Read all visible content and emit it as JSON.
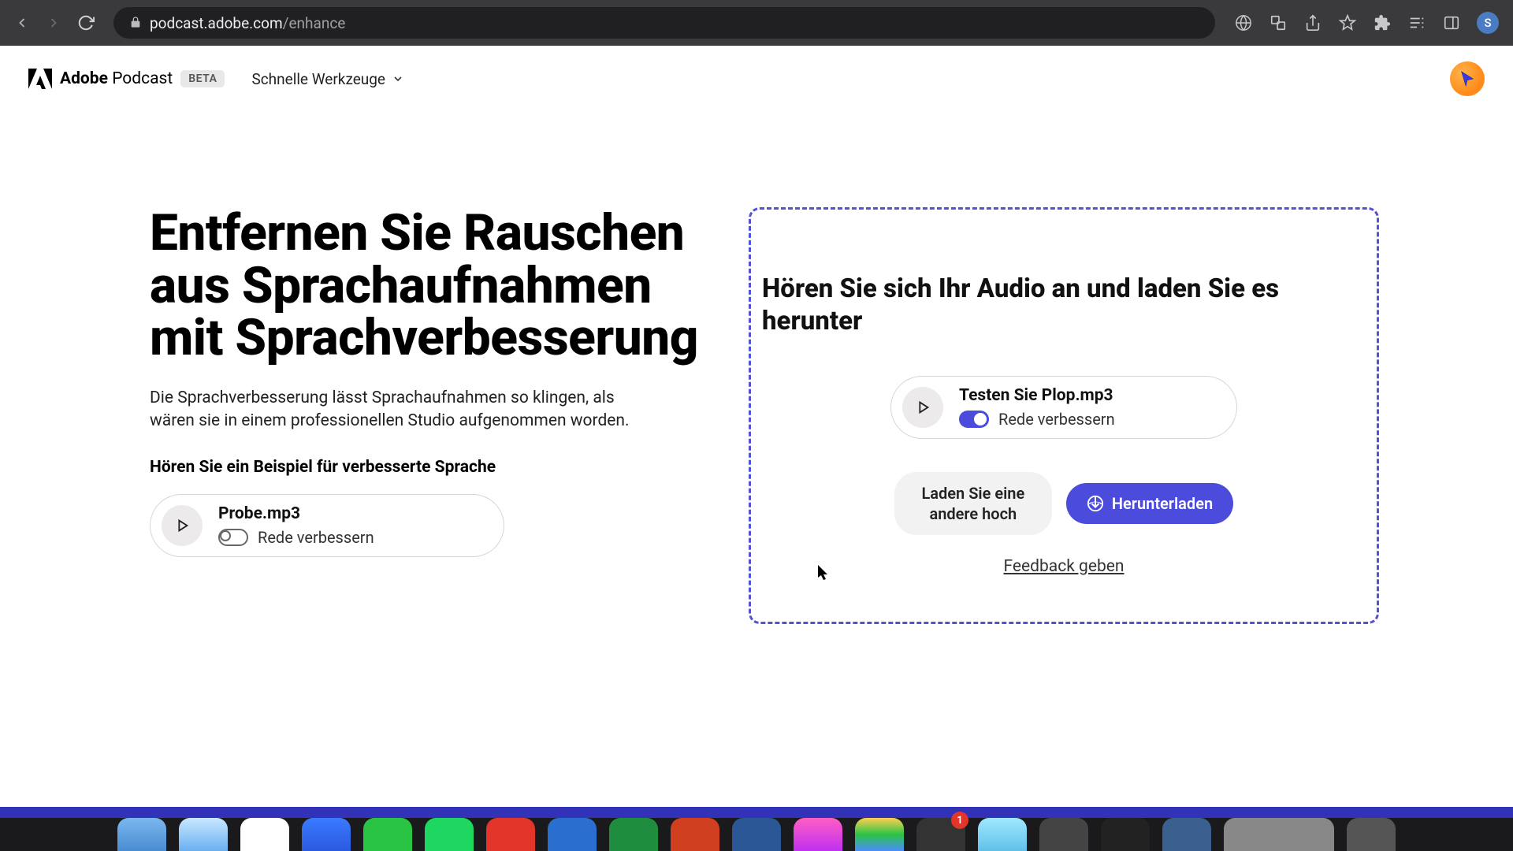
{
  "browser": {
    "url_host": "podcast.adobe.com",
    "url_path": "/enhance",
    "profile_initial": "S"
  },
  "header": {
    "logo_brand": "Adobe",
    "logo_product": "Podcast",
    "beta": "BETA",
    "quick_tools": "Schnelle Werkzeuge"
  },
  "hero": {
    "headline": "Entfernen Sie Rauschen aus Sprachaufnahmen mit Sprachverbesserung",
    "sub": "Die Sprachverbesserung lässt Sprachaufnahmen so klingen, als wären sie in einem professionellen Studio aufgenommen worden.",
    "example_label": "Hören Sie ein Beispiel für verbesserte Sprache",
    "sample_file": "Probe.mp3",
    "sample_toggle": "Rede verbessern"
  },
  "drop": {
    "headline": "Hören Sie sich Ihr Audio an und laden Sie es herunter",
    "user_file": "Testen Sie Plop.mp3",
    "user_toggle": "Rede verbessern",
    "upload_another": "Laden Sie eine andere hoch",
    "download": "Herunterladen",
    "feedback": "Feedback geben"
  },
  "dock": {
    "badge_count": "1"
  }
}
